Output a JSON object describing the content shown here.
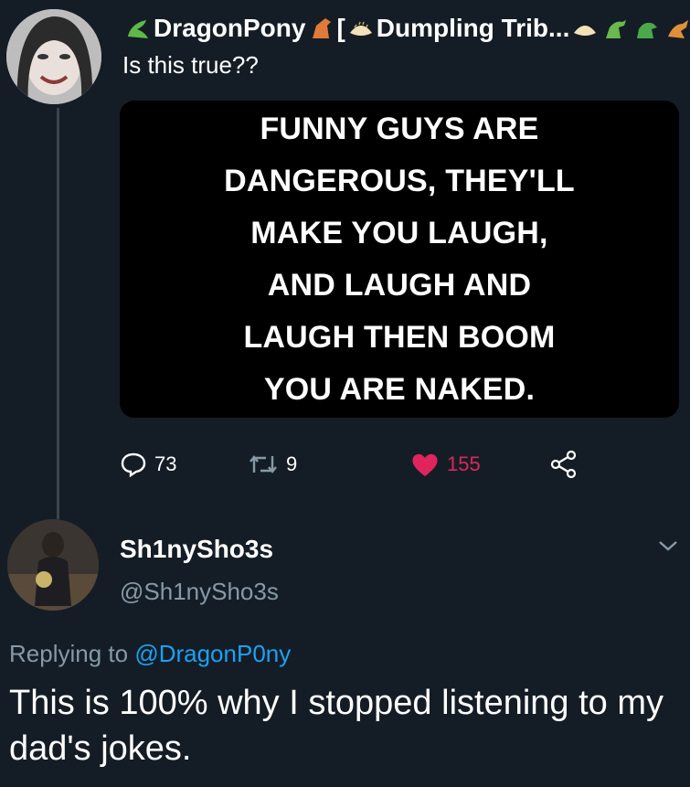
{
  "tweet": {
    "author": {
      "name": "DragonPony",
      "extra": "[",
      "community": "Dumpling Trib...",
      "icons": [
        "dragon-emoji-icon",
        "horse-emoji-icon",
        "dumpling-emoji-icon",
        "dumpling-emoji-icon",
        "dinosaur-emoji-icon",
        "dinosaur-emoji-icon",
        "dinosaur-emoji-icon"
      ]
    },
    "text": "Is this true??",
    "image_text": "FUNNY GUYS ARE\nDANGEROUS, THEY'LL\nMAKE YOU LAUGH,\nAND LAUGH AND\nLAUGH THEN BOOM\nYOU ARE NAKED.",
    "actions": {
      "replies": "73",
      "retweets": "9",
      "likes": "155"
    }
  },
  "reply": {
    "name": "Sh1nySho3s",
    "handle": "@Sh1nySho3s",
    "replying_prefix": "Replying to",
    "replying_to": "@DragonP0ny",
    "text": "This is 100% why I stopped listening to my dad's jokes."
  },
  "colors": {
    "background": "#141d26",
    "muted": "#8899a6",
    "link": "#1da1f2",
    "like": "#e0245e"
  }
}
